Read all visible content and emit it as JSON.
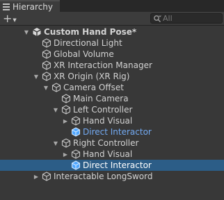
{
  "window": {
    "tab_title": "Hierarchy"
  },
  "toolbar": {
    "add_icon": "plus-icon",
    "search_placeholder": "All",
    "search_icon": "search-icon"
  },
  "tree": [
    {
      "label": "Custom Hand Pose*",
      "depth": 0,
      "expanded": true,
      "has_children": true,
      "icon": "unity-scene-icon",
      "bold": true
    },
    {
      "label": "Directional Light",
      "depth": 1,
      "has_children": false,
      "icon": "gameobject-icon"
    },
    {
      "label": "Global Volume",
      "depth": 1,
      "has_children": false,
      "icon": "gameobject-icon"
    },
    {
      "label": "XR Interaction Manager",
      "depth": 1,
      "has_children": false,
      "icon": "gameobject-icon"
    },
    {
      "label": "XR Origin (XR Rig)",
      "depth": 1,
      "expanded": true,
      "has_children": true,
      "icon": "gameobject-icon"
    },
    {
      "label": "Camera Offset",
      "depth": 2,
      "expanded": true,
      "has_children": true,
      "icon": "gameobject-icon"
    },
    {
      "label": "Main Camera",
      "depth": 3,
      "has_children": false,
      "icon": "gameobject-icon"
    },
    {
      "label": "Left Controller",
      "depth": 3,
      "expanded": true,
      "has_children": true,
      "icon": "gameobject-icon"
    },
    {
      "label": "Hand Visual",
      "depth": 4,
      "expanded": false,
      "has_children": true,
      "icon": "gameobject-icon"
    },
    {
      "label": "Direct Interactor",
      "depth": 4,
      "has_children": false,
      "icon": "prefab-icon",
      "prefab": true
    },
    {
      "label": "Right Controller",
      "depth": 3,
      "expanded": true,
      "has_children": true,
      "icon": "gameobject-icon"
    },
    {
      "label": "Hand Visual",
      "depth": 4,
      "expanded": false,
      "has_children": true,
      "icon": "gameobject-icon"
    },
    {
      "label": "Direct Interactor",
      "depth": 4,
      "has_children": false,
      "icon": "prefab-icon",
      "selected": true
    },
    {
      "label": "Interactable LongSword",
      "depth": 1,
      "expanded": false,
      "has_children": true,
      "icon": "gameobject-icon"
    }
  ],
  "colors": {
    "background": "#383838",
    "selection": "#2c5d87",
    "prefab_text": "#73aaf2",
    "prefab_icon": "#4ea6ff"
  }
}
